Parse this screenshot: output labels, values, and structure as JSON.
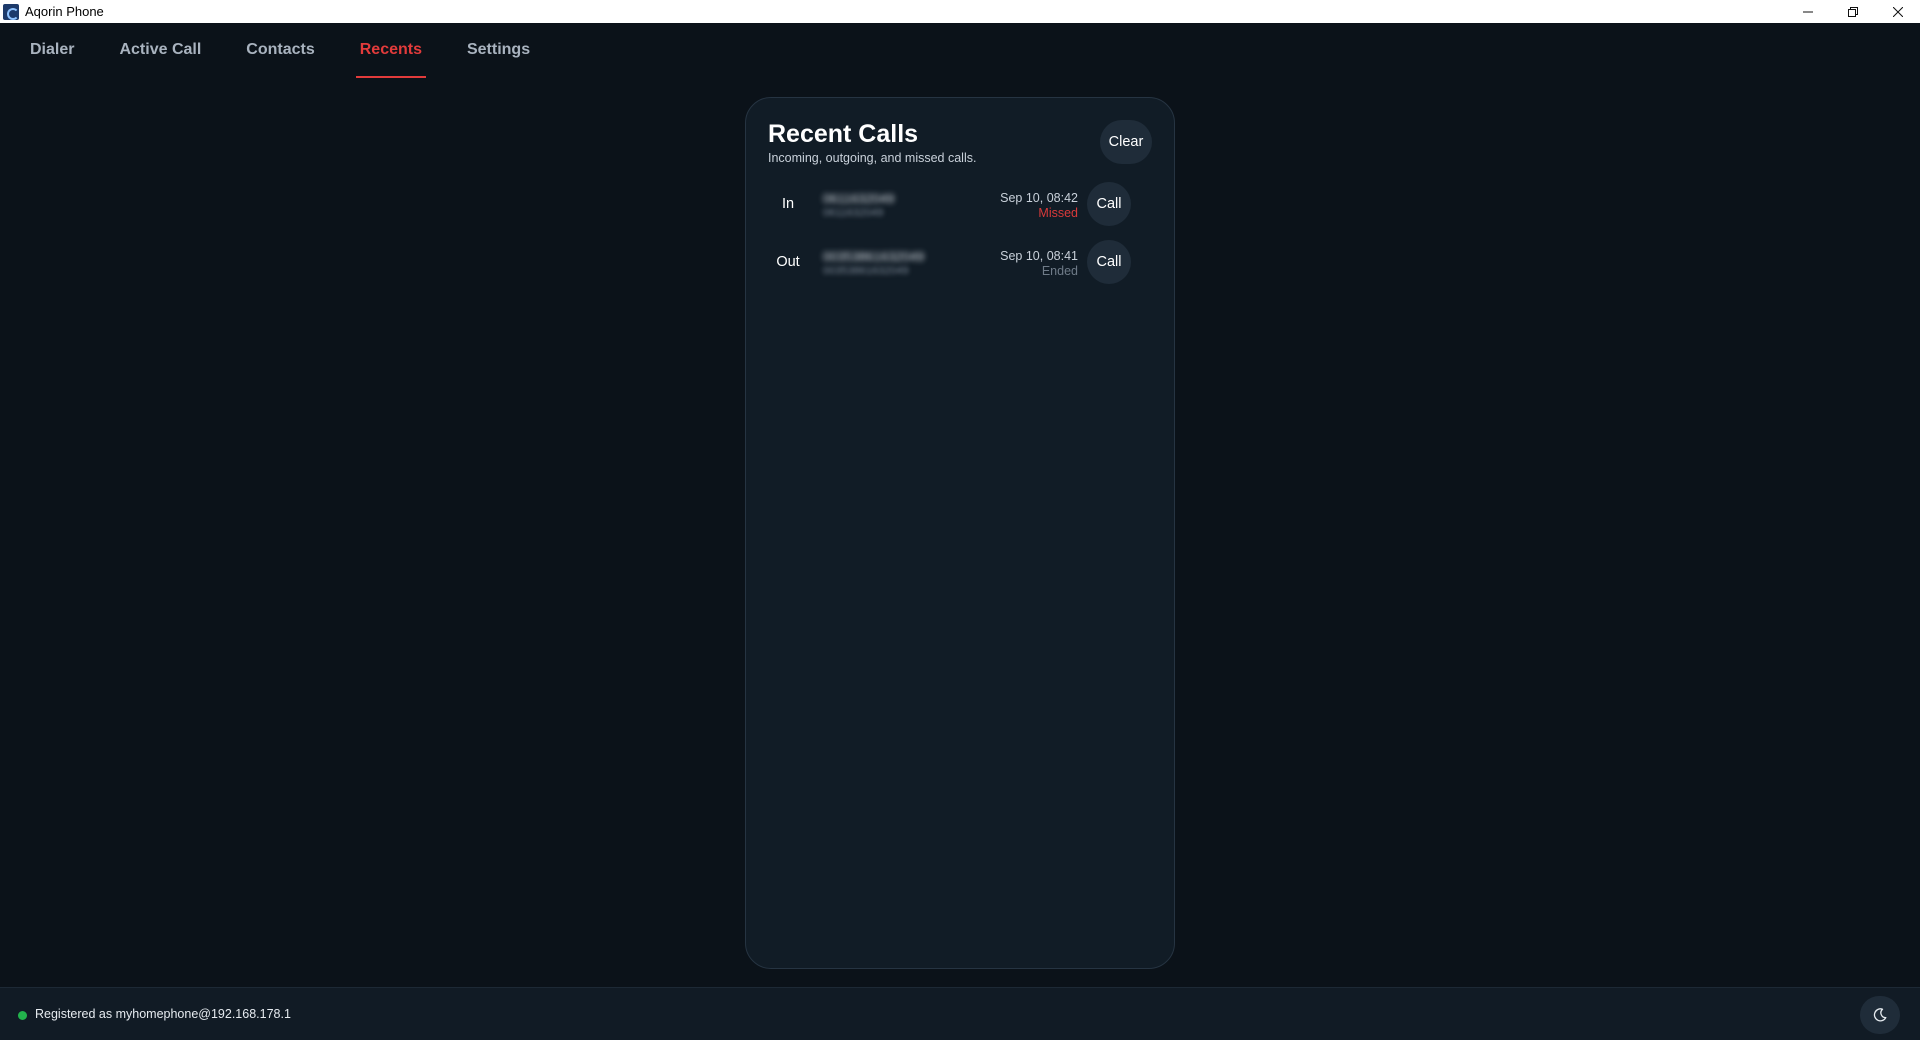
{
  "window": {
    "title": "Aqorin Phone",
    "icon": "app-icon"
  },
  "nav": {
    "tabs": [
      {
        "label": "Dialer"
      },
      {
        "label": "Active Call"
      },
      {
        "label": "Contacts"
      },
      {
        "label": "Recents",
        "active": true
      },
      {
        "label": "Settings"
      }
    ]
  },
  "recents": {
    "title": "Recent Calls",
    "subtitle": "Incoming, outgoing, and missed calls.",
    "clear_label": "Clear",
    "calls": [
      {
        "direction": "In",
        "number": "0611632049",
        "number_sub": "0611632049",
        "time": "Sep 10, 08:42",
        "status": "Missed",
        "call_label": "Call"
      },
      {
        "direction": "Out",
        "number": "00353861632049",
        "number_sub": "00353861632049",
        "time": "Sep 10, 08:41",
        "status": "Ended",
        "call_label": "Call"
      }
    ]
  },
  "footer": {
    "status_text": "Registered as myhomephone@192.168.178.1",
    "status_color": "#22b24c",
    "theme_icon": "moon-icon"
  },
  "colors": {
    "accent": "#e23b3b",
    "background": "#0b1219",
    "card": "#111c26",
    "missed": "#d93a3a"
  }
}
